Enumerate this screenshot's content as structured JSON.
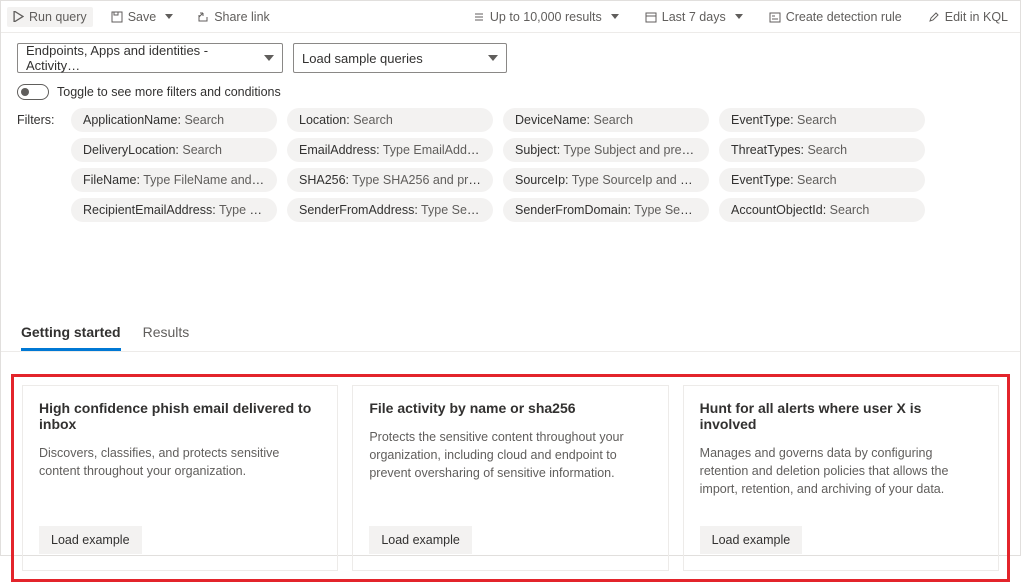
{
  "toolbar": {
    "run_label": "Run query",
    "save_label": "Save",
    "share_label": "Share link",
    "results_limit_label": "Up to 10,000 results",
    "time_range_label": "Last 7 days",
    "create_rule_label": "Create detection rule",
    "edit_kql_label": "Edit in KQL"
  },
  "query": {
    "scope_selected": "Endpoints, Apps and identities - Activity…",
    "sample_label": "Load sample queries"
  },
  "toggle_label": "Toggle to see more filters and conditions",
  "filters_label": "Filters:",
  "filters": [
    [
      {
        "key": "ApplicationName",
        "value": "Search"
      },
      {
        "key": "Location",
        "value": "Search"
      },
      {
        "key": "DeviceName",
        "value": "Search"
      },
      {
        "key": "EventType",
        "value": "Search"
      }
    ],
    [
      {
        "key": "DeliveryLocation",
        "value": "Search"
      },
      {
        "key": "EmailAddress",
        "value": "Type EmailAddres…"
      },
      {
        "key": "Subject",
        "value": "Type Subject and press …"
      },
      {
        "key": "ThreatTypes",
        "value": "Search"
      }
    ],
    [
      {
        "key": "FileName",
        "value": "Type FileName and pr…"
      },
      {
        "key": "SHA256",
        "value": "Type SHA256 and pres…"
      },
      {
        "key": "SourceIp",
        "value": "Type SourceIp and pre…"
      },
      {
        "key": "EventType",
        "value": "Search"
      }
    ],
    [
      {
        "key": "RecipientEmailAddress",
        "value": "Type Rec…"
      },
      {
        "key": "SenderFromAddress",
        "value": "Type Send…"
      },
      {
        "key": "SenderFromDomain",
        "value": "Type Sende…"
      },
      {
        "key": "AccountObjectId",
        "value": "Search"
      }
    ]
  ],
  "tabs": {
    "getting_started": "Getting started",
    "results": "Results"
  },
  "cards": [
    {
      "title": "High confidence phish email delivered to inbox",
      "desc": "Discovers, classifies, and protects sensitive content throughout your organization.",
      "button": "Load example"
    },
    {
      "title": "File activity by name or sha256",
      "desc": "Protects the sensitive content throughout your organization, including cloud and endpoint to prevent oversharing of sensitive information.",
      "button": "Load example"
    },
    {
      "title": "Hunt for all alerts where user X is involved",
      "desc": "Manages and governs data by configuring retention and deletion policies that allows the import, retention, and archiving of your data.",
      "button": "Load example"
    }
  ]
}
